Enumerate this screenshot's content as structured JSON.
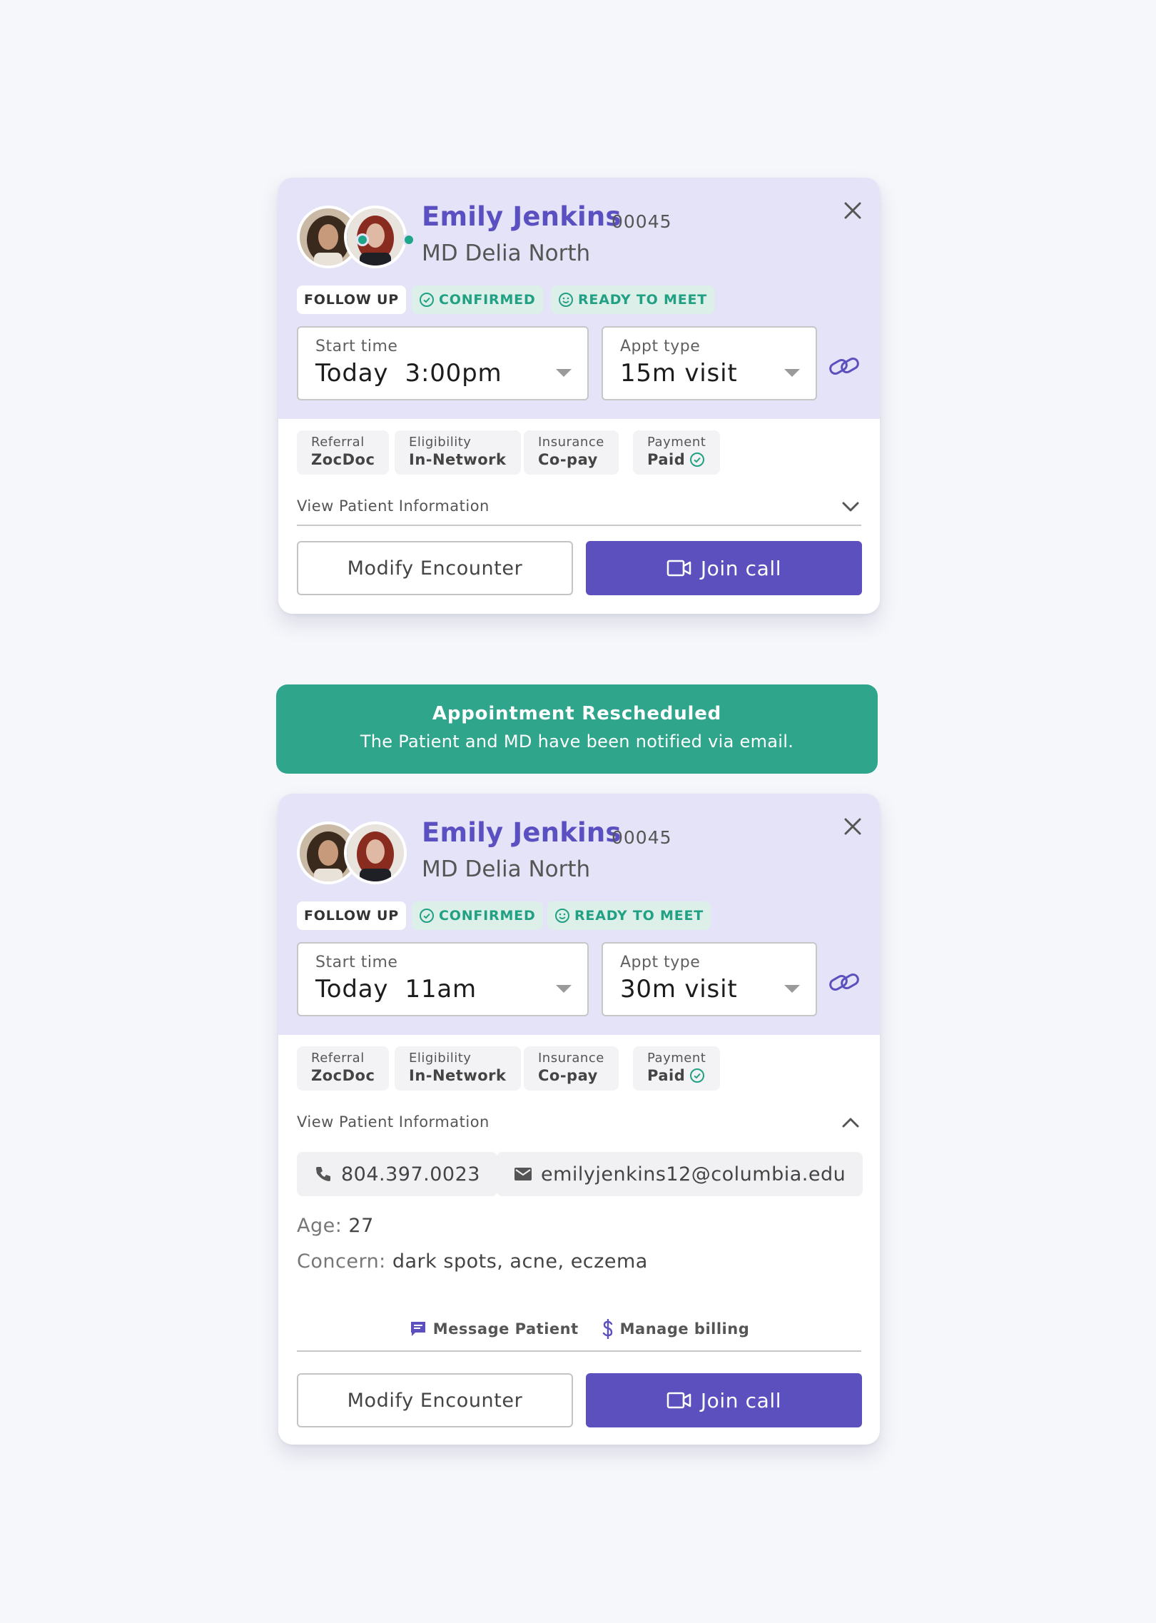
{
  "colors": {
    "accent": "#5b50be",
    "header_bg": "#e4e3f7",
    "success": "#2fa58b",
    "tag_green_text": "#21a083",
    "background": "#f6f7fb"
  },
  "cards": [
    {
      "patient_name": "Emily Jenkins",
      "patient_id": "00045",
      "md_name": "MD Delia North",
      "online_status_dots": true,
      "tags": {
        "follow_up": "FOLLOW UP",
        "confirmed": "CONFIRMED",
        "ready": "READY TO MEET"
      },
      "start_time": {
        "label": "Start time",
        "value": "Today  3:00pm"
      },
      "appt_type": {
        "label": "Appt type",
        "value": "15m visit"
      },
      "chips": [
        {
          "label": "Referral",
          "value": "ZocDoc"
        },
        {
          "label": "Eligibility",
          "value": "In-Network"
        },
        {
          "label": "Insurance",
          "value": "Co-pay"
        },
        {
          "label": "Payment",
          "value": "Paid"
        }
      ],
      "view_patient_info": "View Patient Information",
      "patient_info_expanded": false,
      "buttons": {
        "modify": "Modify Encounter",
        "join": "Join call"
      }
    },
    {
      "patient_name": "Emily Jenkins",
      "patient_id": "00045",
      "md_name": "MD Delia North",
      "online_status_dots": false,
      "tags": {
        "follow_up": "FOLLOW UP",
        "confirmed": "CONFIRMED",
        "ready": "READY TO MEET"
      },
      "start_time": {
        "label": "Start time",
        "value": "Today  11am"
      },
      "appt_type": {
        "label": "Appt type",
        "value": "30m visit"
      },
      "chips": [
        {
          "label": "Referral",
          "value": "ZocDoc"
        },
        {
          "label": "Eligibility",
          "value": "In-Network"
        },
        {
          "label": "Insurance",
          "value": "Co-pay"
        },
        {
          "label": "Payment",
          "value": "Paid"
        }
      ],
      "view_patient_info": "View Patient Information",
      "patient_info_expanded": true,
      "phone": "804.397.0023",
      "email": "emilyjenkins12@columbia.edu",
      "age": {
        "label": "Age:",
        "value": "27"
      },
      "concern": {
        "label": "Concern:",
        "value": "dark spots, acne, eczema"
      },
      "actions": {
        "message": "Message Patient",
        "billing": "Manage billing"
      },
      "buttons": {
        "modify": "Modify Encounter",
        "join": "Join call"
      }
    }
  ],
  "banner": {
    "title": "Appointment Rescheduled",
    "message": "The Patient and MD have been notified via email."
  },
  "icons": [
    "patient-avatar",
    "doctor-avatar",
    "close-icon",
    "check-circle-icon",
    "smile-icon",
    "dropdown-caret-icon",
    "link-icon",
    "chevron-down-icon",
    "chevron-up-icon",
    "video-camera-icon",
    "phone-icon",
    "mail-icon",
    "message-icon",
    "dollar-icon"
  ]
}
